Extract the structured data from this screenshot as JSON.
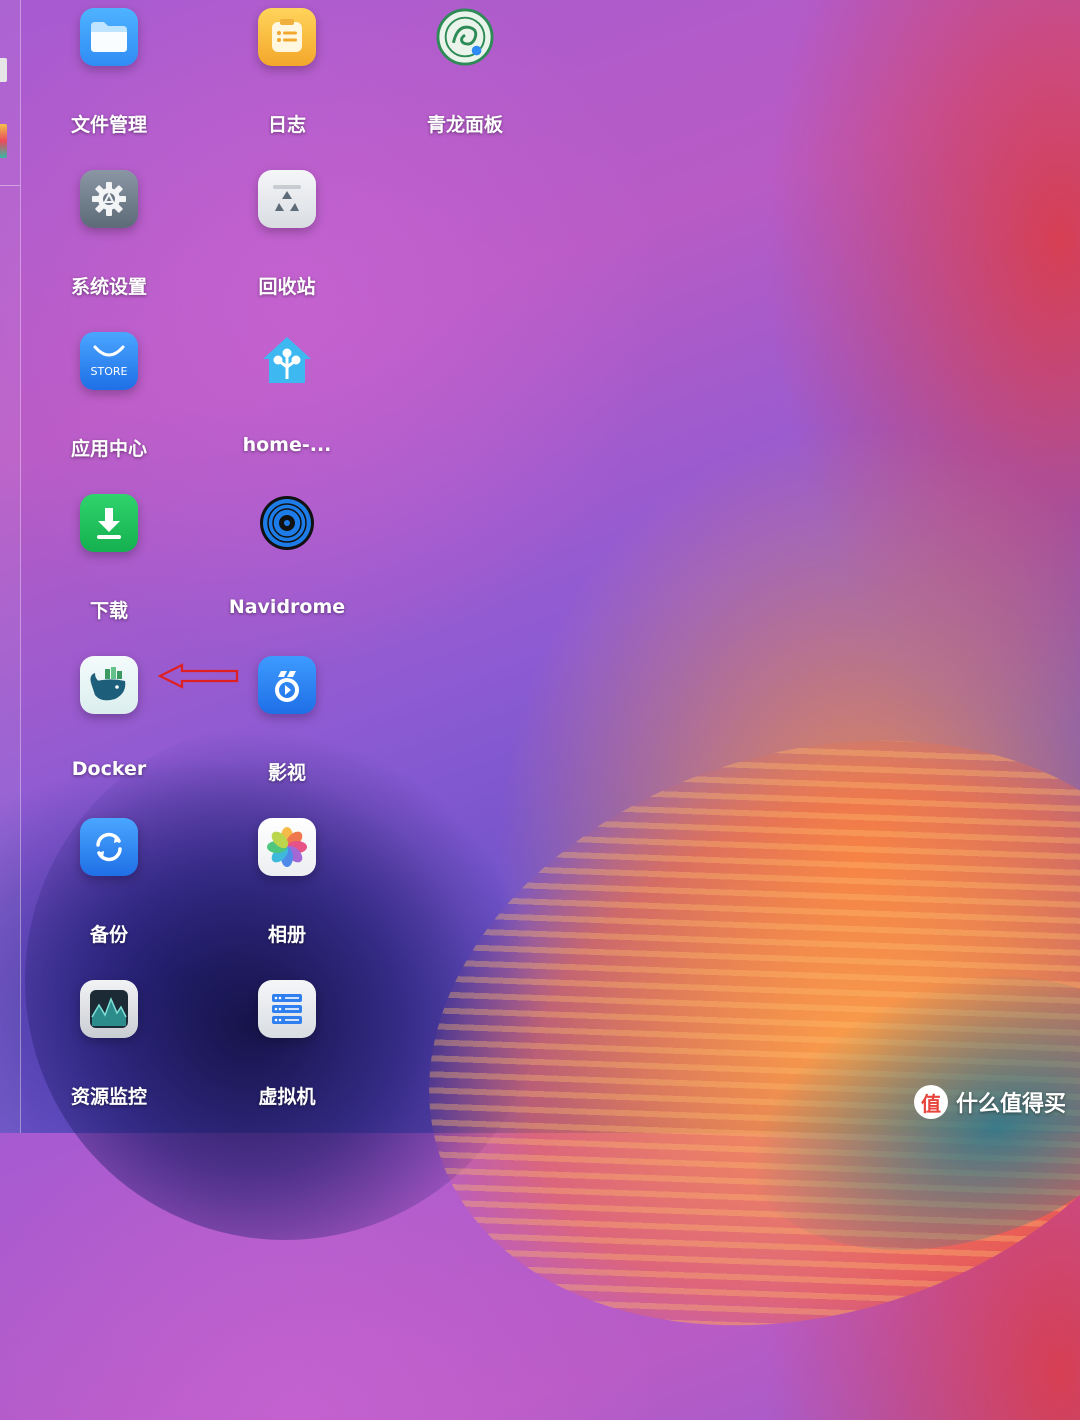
{
  "desktop": {
    "apps": [
      {
        "id": "file-manager",
        "label": "文件管理"
      },
      {
        "id": "log",
        "label": "日志"
      },
      {
        "id": "qinglong",
        "label": "青龙面板"
      },
      {
        "id": "settings",
        "label": "系统设置"
      },
      {
        "id": "recycle",
        "label": "回收站"
      },
      {
        "id": "app-center",
        "label": "应用中心",
        "icon_text": "STORE"
      },
      {
        "id": "home-assistant",
        "label": "home-..."
      },
      {
        "id": "download",
        "label": "下载"
      },
      {
        "id": "navidrome",
        "label": "Navidrome"
      },
      {
        "id": "docker",
        "label": "Docker"
      },
      {
        "id": "video",
        "label": "影视"
      },
      {
        "id": "backup",
        "label": "备份"
      },
      {
        "id": "photos",
        "label": "相册"
      },
      {
        "id": "monitor",
        "label": "资源监控"
      },
      {
        "id": "vm",
        "label": "虚拟机"
      }
    ]
  },
  "annotation": {
    "arrow_color": "#e02020",
    "points_to": "Docker"
  },
  "watermark": {
    "logo_text": "值",
    "text": "什么值得买"
  },
  "colors": {
    "label": "#ffffff",
    "accent_blue": "#2f8cf5",
    "download_green": "#22c25a"
  }
}
